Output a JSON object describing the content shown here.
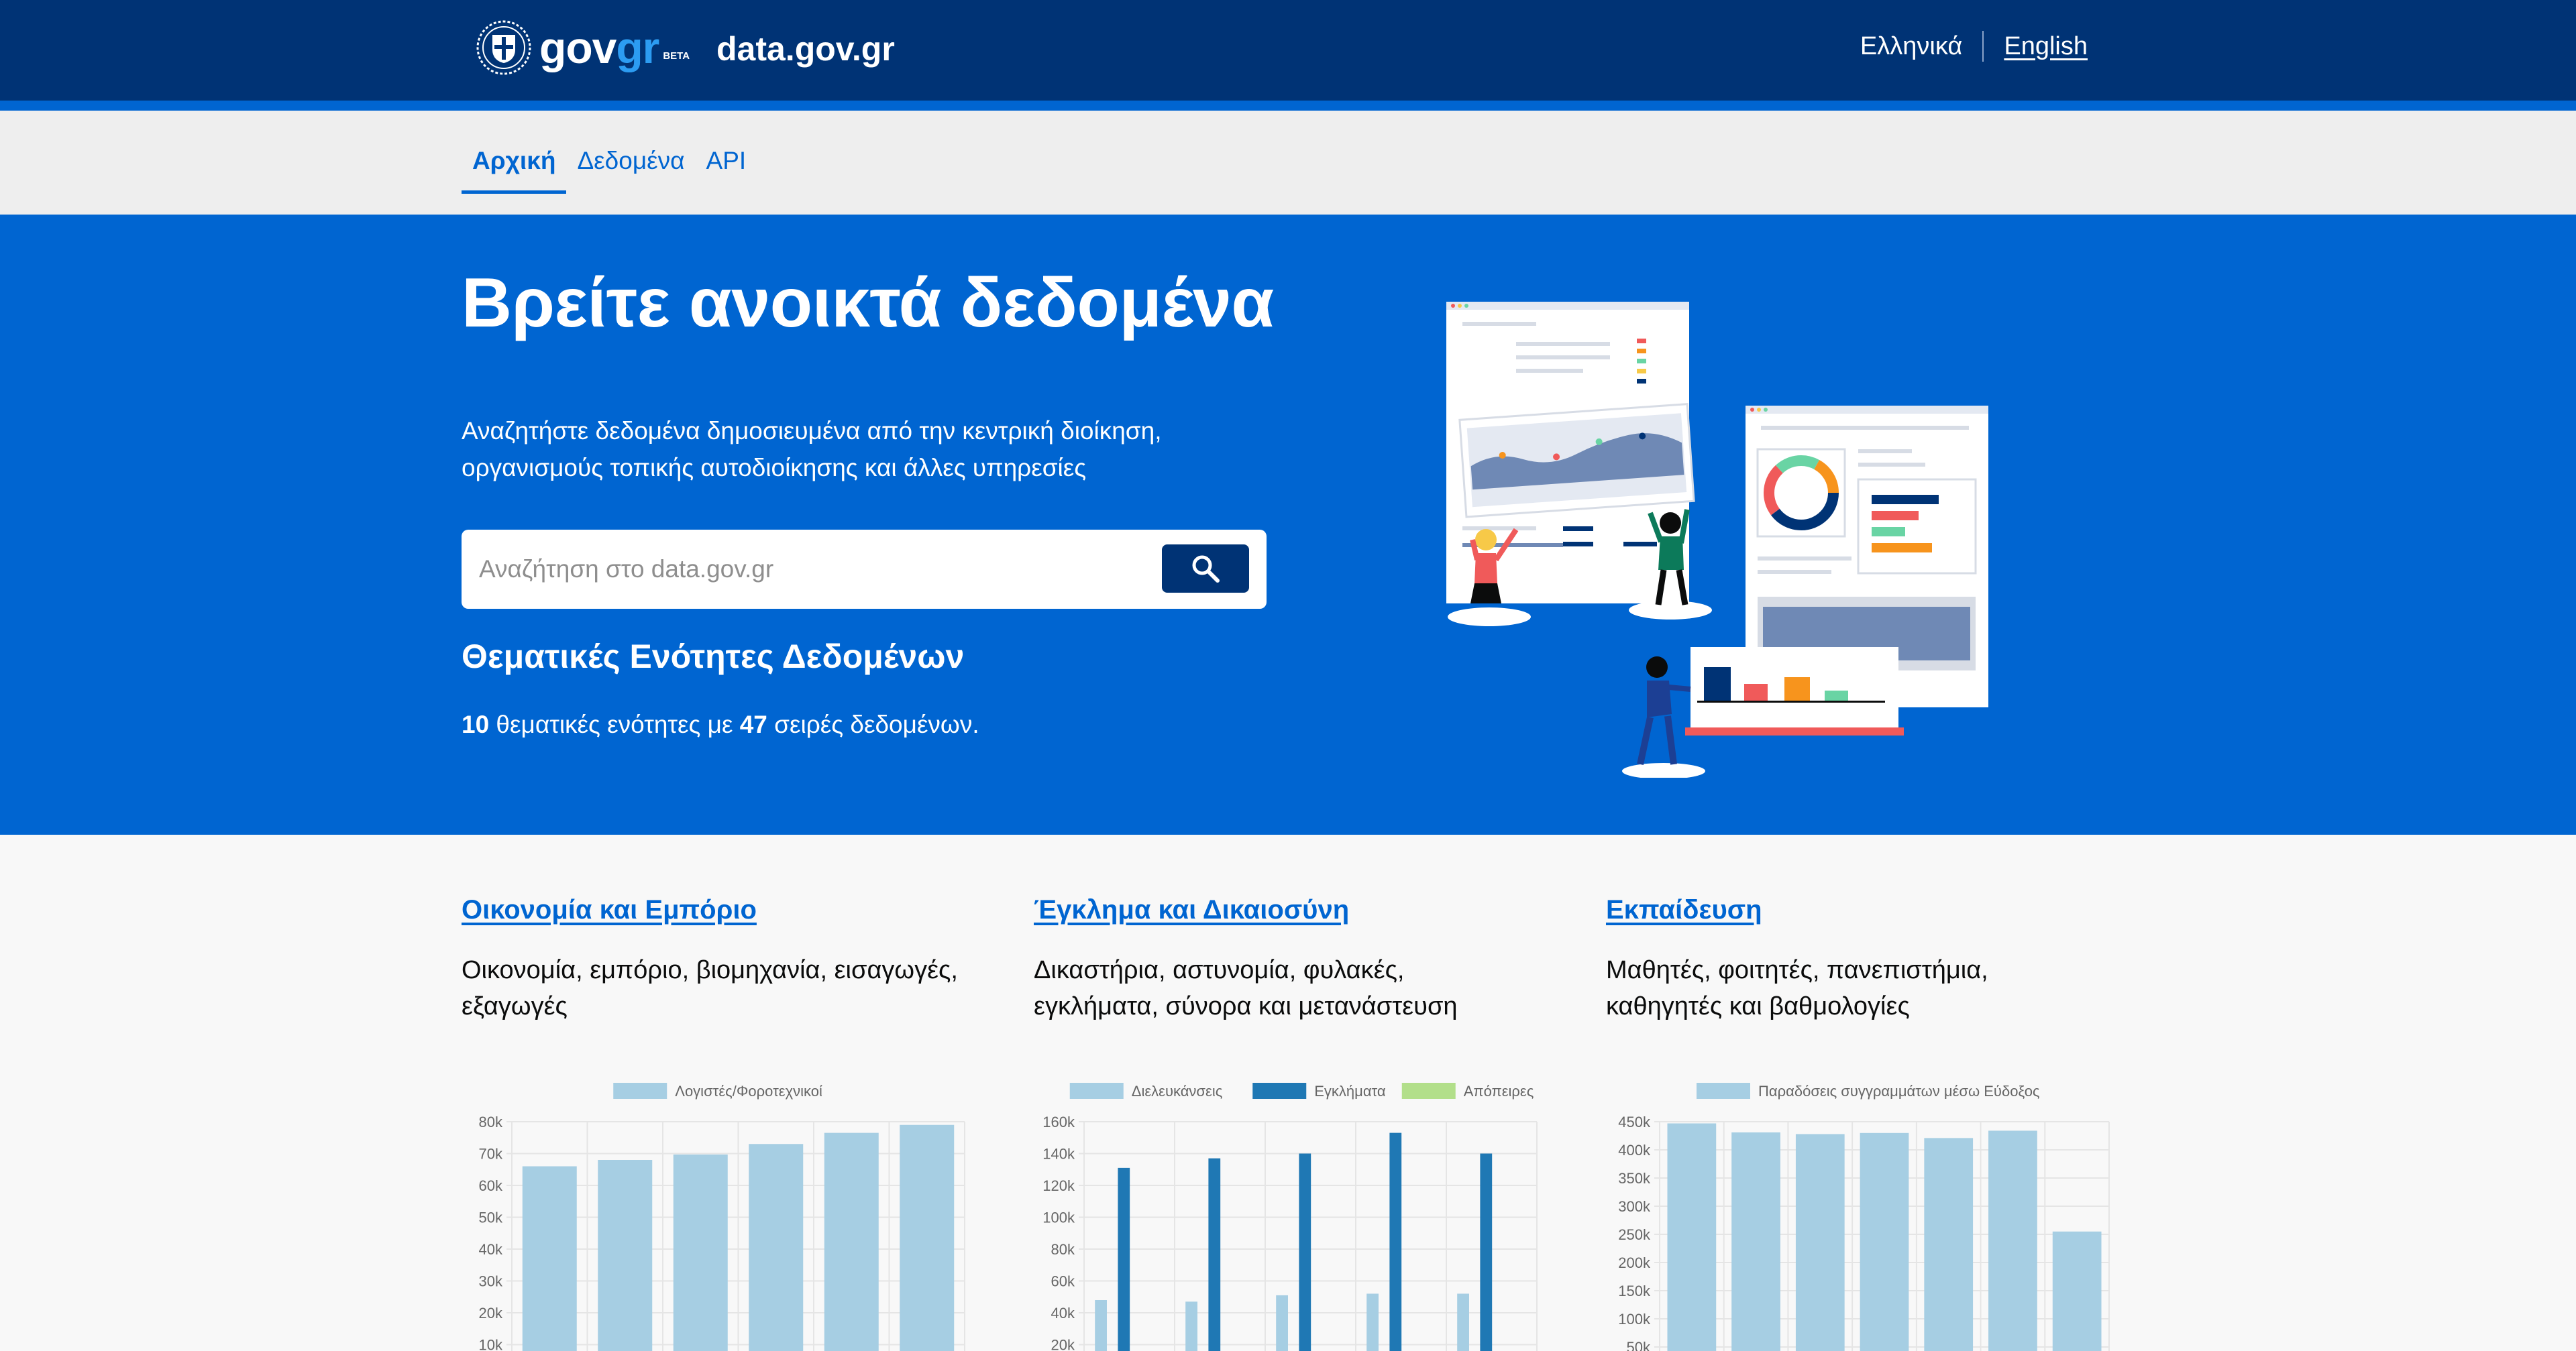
{
  "header": {
    "logo_gov": "gov",
    "logo_gr": "gr",
    "logo_beta": "BETA",
    "site_name": "data.gov.gr",
    "lang_greek": "Ελληνικά",
    "lang_english": "English"
  },
  "nav": {
    "items": [
      {
        "label": "Αρχική",
        "active": true
      },
      {
        "label": "Δεδομένα",
        "active": false
      },
      {
        "label": "API",
        "active": false
      }
    ]
  },
  "hero": {
    "title": "Βρείτε ανοικτά δεδομένα",
    "description_line1": "Αναζητήστε δεδομένα δημοσιευμένα από την κεντρική διοίκηση,",
    "description_line2": "οργανισμούς τοπικής αυτοδιοίκησης και άλλες υπηρεσίες",
    "search_placeholder": "Αναζήτηση στο data.gov.gr",
    "search_icon": "search-icon",
    "topics_title": "Θεματικές Ενότητες Δεδομένων",
    "topics_count": "10",
    "topics_text_mid": " θεματικές ενότητες με ",
    "series_count": "47",
    "topics_text_end": " σειρές δεδομένων."
  },
  "cards": [
    {
      "title": "Οικονομία και Εμπόριο",
      "description_line1": "Οικονομία, εμπόριο, βιομηχανία, εισαγωγές,",
      "description_line2": "εξαγωγές"
    },
    {
      "title": "Έγκλημα και Δικαιοσύνη",
      "description_line1": "Δικαστήρια, αστυνομία, φυλακές,",
      "description_line2": "εγκλήματα, σύνορα και μετανάστευση"
    },
    {
      "title": "Εκπαίδευση",
      "description_line1": "Μαθητές, φοιτητές, πανεπιστήμια,",
      "description_line2": "καθηγητές και βαθμολογίες"
    }
  ],
  "colors": {
    "header_bg": "#003375",
    "primary": "#0065d1",
    "series_light": "#a6cee3",
    "series_dark": "#1f78b4",
    "series_green": "#b2df8a"
  },
  "chart_data": [
    {
      "type": "bar",
      "series": [
        {
          "name": "Λογιστές/Φοροτεχνικοί",
          "color": "#a6cee3",
          "values": [
            66000,
            68000,
            69700,
            73000,
            76500,
            79000
          ]
        }
      ],
      "y_ticks": [
        "80k",
        "70k",
        "60k",
        "50k",
        "40k",
        "30k",
        "20k",
        "10k"
      ],
      "ylim": [
        0,
        80000
      ],
      "legend_position": "top",
      "grid": true
    },
    {
      "type": "bar",
      "series": [
        {
          "name": "Διελευκάνσεις",
          "color": "#a6cee3",
          "values": [
            48000,
            47000,
            51000,
            52000,
            52000
          ]
        },
        {
          "name": "Εγκλήματα",
          "color": "#1f78b4",
          "values": [
            131000,
            137000,
            140000,
            153000,
            140000
          ]
        },
        {
          "name": "Απόπειρες",
          "color": "#b2df8a",
          "values": [
            0,
            0,
            0,
            0,
            0
          ]
        }
      ],
      "y_ticks": [
        "160k",
        "140k",
        "120k",
        "100k",
        "80k",
        "60k",
        "40k",
        "20k"
      ],
      "ylim": [
        0,
        160000
      ],
      "legend_position": "top",
      "grid": true
    },
    {
      "type": "bar",
      "series": [
        {
          "name": "Παραδόσεις συγγραμμάτων μέσω Εύδοξος",
          "color": "#a6cee3",
          "values": [
            447000,
            431000,
            428000,
            430000,
            421000,
            434000,
            255000
          ]
        }
      ],
      "y_ticks": [
        "450k",
        "400k",
        "350k",
        "300k",
        "250k",
        "200k",
        "150k",
        "100k",
        "50k"
      ],
      "ylim": [
        0,
        450000
      ],
      "legend_position": "top",
      "grid": true
    }
  ]
}
